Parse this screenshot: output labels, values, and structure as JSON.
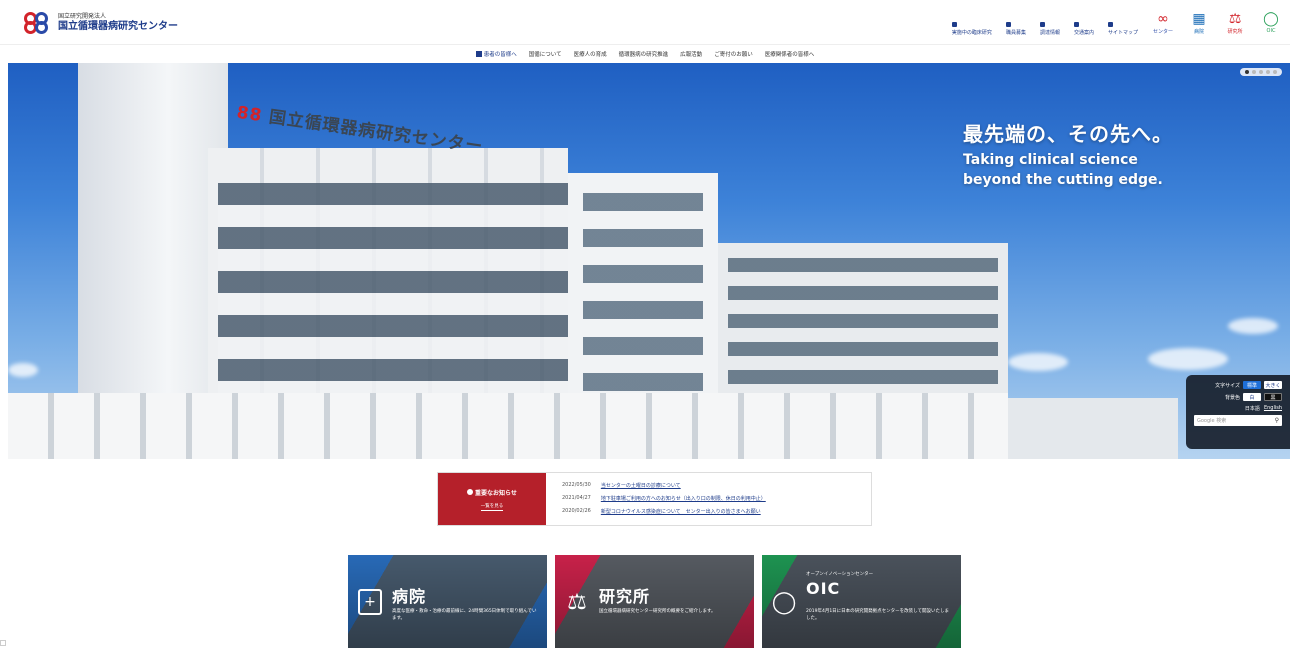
{
  "header": {
    "logo_sub": "国立研究開発法人",
    "logo_main": "国立循環器病研究センター",
    "util_links": [
      "実施中の臨床研究",
      "職員募集",
      "調達情報",
      "交通案内",
      "サイトマップ"
    ],
    "org_icons": [
      {
        "label": "センター",
        "icon": "88-logo-icon"
      },
      {
        "label": "病院",
        "icon": "hospital-icon"
      },
      {
        "label": "研究所",
        "icon": "microscope-icon"
      },
      {
        "label": "OIC",
        "icon": "lightbulb-icon"
      }
    ]
  },
  "nav": {
    "items": [
      "患者の皆様へ",
      "国循について",
      "医療人の育成",
      "循環器病の研究推進",
      "広報活動",
      "ご寄付のお願い",
      "医療関係者の皆様へ"
    ]
  },
  "hero": {
    "building_sign": "国立循環器病研究センター",
    "tagline_ja": "最先端の、その先へ。",
    "tagline_en": "Taking clinical science beyond the cutting edge.",
    "slide_count": 5,
    "active_slide": 1
  },
  "accessibility": {
    "font_size_label": "文字サイズ",
    "font_standard": "標準",
    "font_large": "大きく",
    "bg_label": "背景色",
    "bg_white": "白",
    "bg_black": "黒",
    "lang_ja": "日本語",
    "lang_en": "English",
    "search_placeholder": "Google 検索"
  },
  "news": {
    "title": "重要なお知らせ",
    "more": "一覧を見る",
    "items": [
      {
        "date": "2022/05/30",
        "text": "当センターの土曜日の診療について"
      },
      {
        "date": "2021/04/27",
        "text": "地下駐車場ご利用の方へのお知らせ（出入り口の制限、休日の利用中止）"
      },
      {
        "date": "2020/02/26",
        "text": "新型コロナウイルス感染症について　センター出入りの皆さまへお願い"
      }
    ]
  },
  "cards": [
    {
      "title": "病院",
      "kicker": "",
      "desc": "高度な医療・救命・治療の最前線に、24時間365日体制で取り組んでいます。"
    },
    {
      "title": "研究所",
      "kicker": "",
      "desc": "国立循環器病研究センター研究所の概要をご紹介します。"
    },
    {
      "title": "OIC",
      "kicker": "オープンイノベーションセンター",
      "desc": "2019年4月1日に日本の研究開発拠点センターを改装して開設いたしました。"
    }
  ],
  "colors": {
    "brand_blue": "#1e3c8a",
    "brand_red": "#d2232a",
    "news_red": "#b5202a",
    "hospital_blue": "#2a6fc0",
    "research_pink": "#d2234d",
    "oic_green": "#1f9a55"
  }
}
